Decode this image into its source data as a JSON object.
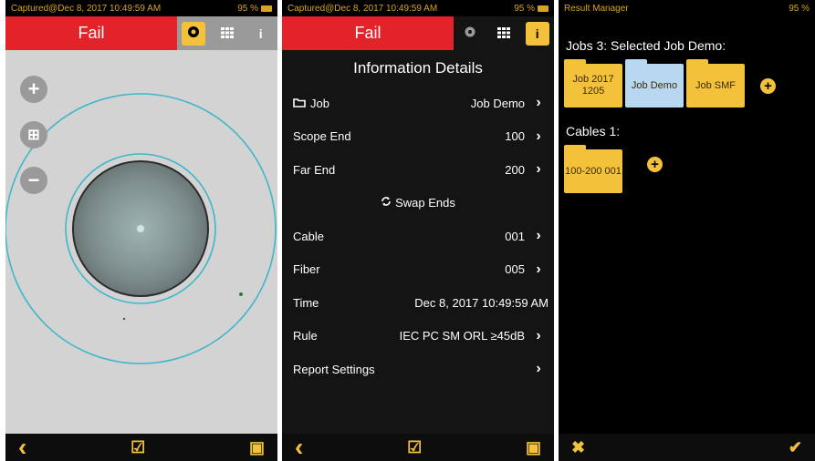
{
  "colors": {
    "accent": "#f4c23a",
    "fail_red": "#e32229",
    "ring_blue": "#3fb6c9"
  },
  "panel1": {
    "status": {
      "left": "Captured@Dec 8, 2017 10:49:59 AM",
      "battery": "95 %"
    },
    "title": "Fail",
    "tabs": [
      {
        "icon": "eye-icon",
        "active": true
      },
      {
        "icon": "grid-icon",
        "active": false
      },
      {
        "icon": "info-icon",
        "active": false
      }
    ],
    "info_glyph": "i",
    "zoom": {
      "plus": "+",
      "fit": "⊞",
      "minus": "−"
    },
    "bottom": {
      "back": "‹",
      "check": "☑",
      "save": "▣"
    }
  },
  "panel2": {
    "status": {
      "left": "Captured@Dec 8, 2017 10:49:59 AM",
      "battery": "95 %"
    },
    "title": "Fail",
    "info_glyph": "i",
    "heading": "Information Details",
    "rows": [
      {
        "label": "Job",
        "value": "Job Demo",
        "chevron": true
      },
      {
        "label": "Scope End",
        "value": "100",
        "chevron": true
      },
      {
        "label": "Far End",
        "value": "200",
        "chevron": true
      },
      {
        "label": "Swap Ends",
        "value": "",
        "chevron": false
      },
      {
        "label": "Cable",
        "value": "001",
        "chevron": true
      },
      {
        "label": "Fiber",
        "value": "005",
        "chevron": true
      },
      {
        "label": "Time",
        "value": "Dec 8, 2017 10:49:59 AM",
        "chevron": false
      },
      {
        "label": "Rule",
        "value": "IEC PC SM ORL ≥45dB",
        "chevron": true
      },
      {
        "label": "Report Settings",
        "value": "",
        "chevron": true
      }
    ],
    "chevron_glyph": "›",
    "bottom": {
      "back": "‹",
      "check": "☑",
      "save": "▣"
    }
  },
  "panel3": {
    "status": {
      "left": "Result Manager",
      "battery": "95 %"
    },
    "jobs_title": "Jobs 3: Selected Job Demo:",
    "jobs": [
      {
        "label": "Job 2017 1205",
        "color": "yellow"
      },
      {
        "label": "Job Demo",
        "color": "blue"
      },
      {
        "label": "Job SMF",
        "color": "yellow"
      }
    ],
    "cables_title": "Cables 1:",
    "cables": [
      {
        "label": "100-200 001",
        "color": "yellow"
      }
    ],
    "add_glyph": "+",
    "bottom": {
      "cancel": "✖",
      "confirm": "✔"
    }
  }
}
